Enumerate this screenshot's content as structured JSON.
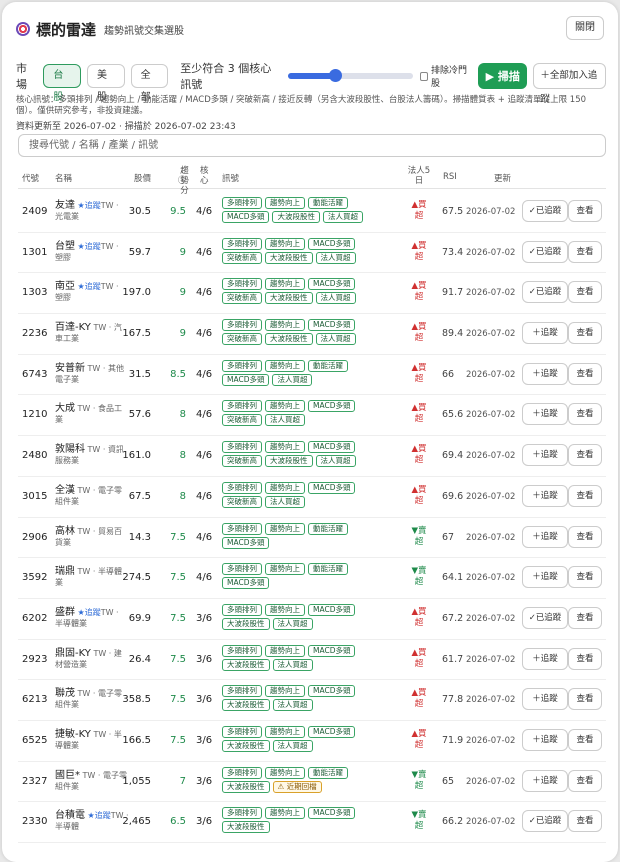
{
  "header": {
    "title": "標的雷達",
    "subtitle": "趨勢訊號交集選股",
    "close_label": "關閉"
  },
  "toolbar": {
    "market_label": "市場",
    "markets": [
      "台股",
      "美股",
      "全部"
    ],
    "min_prefix": "至少符合",
    "min_value": "3",
    "min_suffix": "個核心訊號",
    "slider_fraction": 0.38,
    "exclude_label": "排除冷門股",
    "scan_label": "▶ 掃描",
    "add_all_label": "＋全部加入追蹤"
  },
  "note": "核心訊號：多頭排列 / 趨勢向上 / 動能活躍 / MACD多頭 / 突破新高 / 接近反轉（另含大波段股性、台股法人籌碼）。掃描體質表 + 追蹤清單（上限 150 個）。僅供研究參考，非投資建議。",
  "updated": "資料更新至 2026-07-02 · 掃描於 2026-07-02 23:43",
  "search_placeholder": "搜尋代號 / 名稱 / 產業 / 訊號",
  "columns": {
    "code": "代號",
    "name": "名稱",
    "price": "股價",
    "score": "趨勢分",
    "core": "核心",
    "signals": "訊號",
    "inst": "法人5日",
    "rsi": "RSI",
    "date": "更新"
  },
  "score_info_icon": "ⓘ",
  "rows": [
    {
      "code": "2409",
      "name": "友達",
      "tracked": "★追蹤",
      "industry": "TW · 光電業",
      "price": "30.5",
      "score": "9.5",
      "core": "4/6",
      "tags": [
        "多頭排列",
        "趨勢向上",
        "動能活躍",
        "MACD多頭",
        "大波段股性",
        "法人買超"
      ],
      "inst_arrow": "▲",
      "inst": "買超",
      "inst_dir": "buy",
      "rsi": "67.5",
      "date": "2026-07-02",
      "track_label": "✓已追蹤",
      "view_label": "查看"
    },
    {
      "code": "1301",
      "name": "台塑",
      "tracked": "★追蹤",
      "industry": "TW · 塑膠",
      "price": "59.7",
      "score": "9",
      "core": "4/6",
      "tags": [
        "多頭排列",
        "趨勢向上",
        "MACD多頭",
        "突破新高",
        "大波段股性",
        "法人買超"
      ],
      "inst_arrow": "▲",
      "inst": "買超",
      "inst_dir": "buy",
      "rsi": "73.4",
      "date": "2026-07-02",
      "track_label": "✓已追蹤",
      "view_label": "查看"
    },
    {
      "code": "1303",
      "name": "南亞",
      "tracked": "★追蹤",
      "industry": "TW · 塑膠",
      "price": "197.0",
      "score": "9",
      "core": "4/6",
      "tags": [
        "多頭排列",
        "趨勢向上",
        "MACD多頭",
        "突破新高",
        "大波段股性",
        "法人買超"
      ],
      "inst_arrow": "▲",
      "inst": "買超",
      "inst_dir": "buy",
      "rsi": "91.7",
      "date": "2026-07-02",
      "track_label": "✓已追蹤",
      "view_label": "查看"
    },
    {
      "code": "2236",
      "name": "百達-KY",
      "tracked": "",
      "industry": "TW · 汽車工業",
      "price": "167.5",
      "score": "9",
      "core": "4/6",
      "tags": [
        "多頭排列",
        "趨勢向上",
        "MACD多頭",
        "突破新高",
        "大波段股性",
        "法人買超"
      ],
      "inst_arrow": "▲",
      "inst": "買超",
      "inst_dir": "buy",
      "rsi": "89.4",
      "date": "2026-07-02",
      "track_label": "＋追蹤",
      "view_label": "查看"
    },
    {
      "code": "6743",
      "name": "安普新",
      "tracked": "",
      "industry": "TW · 其他電子業",
      "price": "31.5",
      "score": "8.5",
      "core": "4/6",
      "tags": [
        "多頭排列",
        "趨勢向上",
        "動能活躍",
        "MACD多頭",
        "法人買超"
      ],
      "inst_arrow": "▲",
      "inst": "買超",
      "inst_dir": "buy",
      "rsi": "66",
      "date": "2026-07-02",
      "track_label": "＋追蹤",
      "view_label": "查看"
    },
    {
      "code": "1210",
      "name": "大成",
      "tracked": "",
      "industry": "TW · 食品工業",
      "price": "57.6",
      "score": "8",
      "core": "4/6",
      "tags": [
        "多頭排列",
        "趨勢向上",
        "MACD多頭",
        "突破新高",
        "法人買超"
      ],
      "inst_arrow": "▲",
      "inst": "買超",
      "inst_dir": "buy",
      "rsi": "65.6",
      "date": "2026-07-02",
      "track_label": "＋追蹤",
      "view_label": "查看"
    },
    {
      "code": "2480",
      "name": "敦陽科",
      "tracked": "",
      "industry": "TW · 資訊服務業",
      "price": "161.0",
      "score": "8",
      "core": "4/6",
      "tags": [
        "多頭排列",
        "趨勢向上",
        "MACD多頭",
        "突破新高",
        "大波段股性",
        "法人買超"
      ],
      "inst_arrow": "▲",
      "inst": "買超",
      "inst_dir": "buy",
      "rsi": "69.4",
      "date": "2026-07-02",
      "track_label": "＋追蹤",
      "view_label": "查看"
    },
    {
      "code": "3015",
      "name": "全漢",
      "tracked": "",
      "industry": "TW · 電子零組件業",
      "price": "67.5",
      "score": "8",
      "core": "4/6",
      "tags": [
        "多頭排列",
        "趨勢向上",
        "MACD多頭",
        "突破新高",
        "法人買超"
      ],
      "inst_arrow": "▲",
      "inst": "買超",
      "inst_dir": "buy",
      "rsi": "69.6",
      "date": "2026-07-02",
      "track_label": "＋追蹤",
      "view_label": "查看"
    },
    {
      "code": "2906",
      "name": "高林",
      "tracked": "",
      "industry": "TW · 貿易百貨業",
      "price": "14.3",
      "score": "7.5",
      "core": "4/6",
      "tags": [
        "多頭排列",
        "趨勢向上",
        "動能活躍",
        "MACD多頭"
      ],
      "inst_arrow": "▼",
      "inst": "賣超",
      "inst_dir": "sell",
      "rsi": "67",
      "date": "2026-07-02",
      "track_label": "＋追蹤",
      "view_label": "查看"
    },
    {
      "code": "3592",
      "name": "瑞鼎",
      "tracked": "",
      "industry": "TW · 半導體業",
      "price": "274.5",
      "score": "7.5",
      "core": "4/6",
      "tags": [
        "多頭排列",
        "趨勢向上",
        "動能活躍",
        "MACD多頭"
      ],
      "inst_arrow": "▼",
      "inst": "賣超",
      "inst_dir": "sell",
      "rsi": "64.1",
      "date": "2026-07-02",
      "track_label": "＋追蹤",
      "view_label": "查看"
    },
    {
      "code": "6202",
      "name": "盛群",
      "tracked": "★追蹤",
      "industry": "TW · 半導體業",
      "price": "69.9",
      "score": "7.5",
      "core": "3/6",
      "tags": [
        "多頭排列",
        "趨勢向上",
        "MACD多頭",
        "大波段股性",
        "法人買超"
      ],
      "inst_arrow": "▲",
      "inst": "買超",
      "inst_dir": "buy",
      "rsi": "67.2",
      "date": "2026-07-02",
      "track_label": "✓已追蹤",
      "view_label": "查看"
    },
    {
      "code": "2923",
      "name": "鼎固-KY",
      "tracked": "",
      "industry": "TW · 建材營造業",
      "price": "26.4",
      "score": "7.5",
      "core": "3/6",
      "tags": [
        "多頭排列",
        "趨勢向上",
        "MACD多頭",
        "大波段股性",
        "法人買超"
      ],
      "inst_arrow": "▲",
      "inst": "買超",
      "inst_dir": "buy",
      "rsi": "61.7",
      "date": "2026-07-02",
      "track_label": "＋追蹤",
      "view_label": "查看"
    },
    {
      "code": "6213",
      "name": "聯茂",
      "tracked": "",
      "industry": "TW · 電子零組件業",
      "price": "358.5",
      "score": "7.5",
      "core": "3/6",
      "tags": [
        "多頭排列",
        "趨勢向上",
        "MACD多頭",
        "大波段股性",
        "法人買超"
      ],
      "inst_arrow": "▲",
      "inst": "買超",
      "inst_dir": "buy",
      "rsi": "77.8",
      "date": "2026-07-02",
      "track_label": "＋追蹤",
      "view_label": "查看"
    },
    {
      "code": "6525",
      "name": "捷敏-KY",
      "tracked": "",
      "industry": "TW · 半導體業",
      "price": "166.5",
      "score": "7.5",
      "core": "3/6",
      "tags": [
        "多頭排列",
        "趨勢向上",
        "MACD多頭",
        "大波段股性",
        "法人買超"
      ],
      "inst_arrow": "▲",
      "inst": "買超",
      "inst_dir": "buy",
      "rsi": "71.9",
      "date": "2026-07-02",
      "track_label": "＋追蹤",
      "view_label": "查看"
    },
    {
      "code": "2327",
      "name": "國巨*",
      "tracked": "",
      "industry": "TW · 電子零組件業",
      "price": "1,055",
      "score": "7",
      "core": "3/6",
      "tags": [
        "多頭排列",
        "趨勢向上",
        "動能活躍",
        "大波段股性",
        "⚠ 近期回檔"
      ],
      "inst_arrow": "▼",
      "inst": "賣超",
      "inst_dir": "sell",
      "rsi": "65",
      "date": "2026-07-02",
      "track_label": "＋追蹤",
      "view_label": "查看"
    },
    {
      "code": "2330",
      "name": "台積電",
      "tracked": "★追蹤",
      "industry": "TW · 半導體",
      "price": "2,465",
      "score": "6.5",
      "core": "3/6",
      "tags": [
        "多頭排列",
        "趨勢向上",
        "MACD多頭",
        "大波段股性"
      ],
      "inst_arrow": "▼",
      "inst": "賣超",
      "inst_dir": "sell",
      "rsi": "66.2",
      "date": "2026-07-02",
      "track_label": "✓已追蹤",
      "view_label": "查看"
    }
  ]
}
